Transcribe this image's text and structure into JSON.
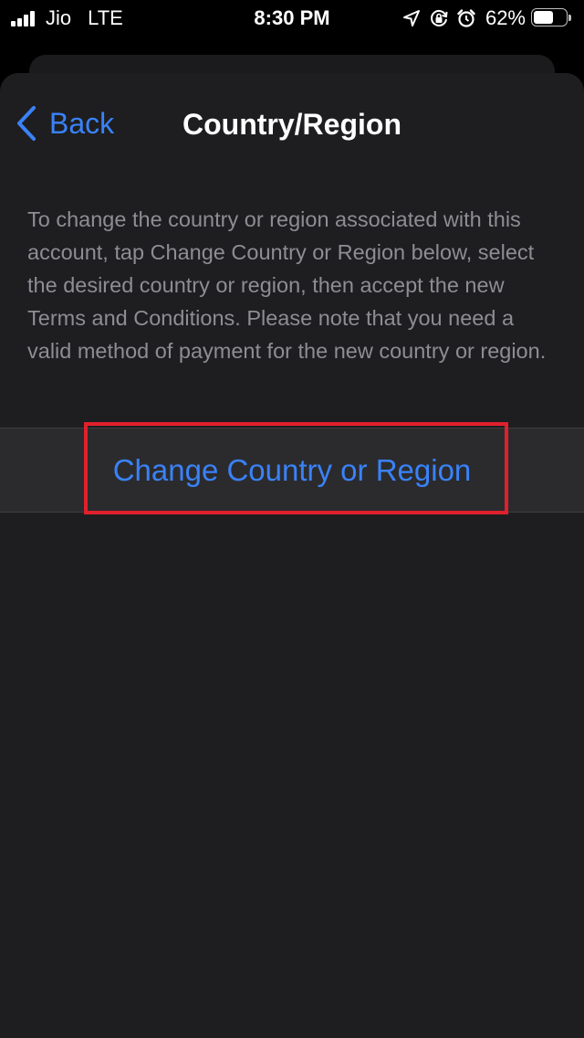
{
  "status_bar": {
    "carrier": "Jio",
    "network": "LTE",
    "time": "8:30 PM",
    "battery_percent": "62%",
    "battery_level": 0.62,
    "icons": [
      "location-arrow-icon",
      "rotation-lock-icon",
      "alarm-icon"
    ]
  },
  "nav": {
    "back_label": "Back",
    "title": "Country/Region"
  },
  "content": {
    "description": "To change the country or region associated with this account, tap Change Country or Region below, select the desired country or region, then accept the new Terms and Conditions. Please note that you need a valid method of payment for the new country or region.",
    "action_label": "Change Country or Region"
  },
  "colors": {
    "accent": "#3a82f7",
    "highlight": "#e0202c",
    "background": "#1e1e20",
    "secondary_text": "#8d8d93"
  }
}
